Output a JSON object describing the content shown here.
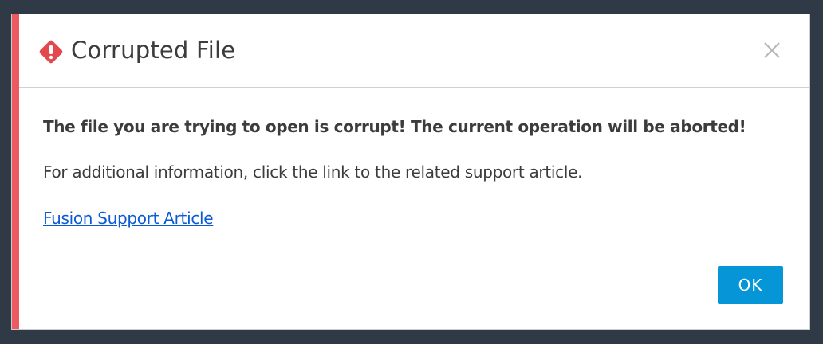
{
  "dialog": {
    "title": "Corrupted File",
    "title_icon": "error-diamond-icon",
    "close_icon": "close-icon",
    "accent_color": "#ec5a5f",
    "message_bold": "The file you are trying to open is corrupt! The current operation will be aborted!",
    "message": "For additional information, click the link to the related support article.",
    "link_label": "Fusion Support Article",
    "ok_label": "OK",
    "ok_color": "#0696d7"
  }
}
